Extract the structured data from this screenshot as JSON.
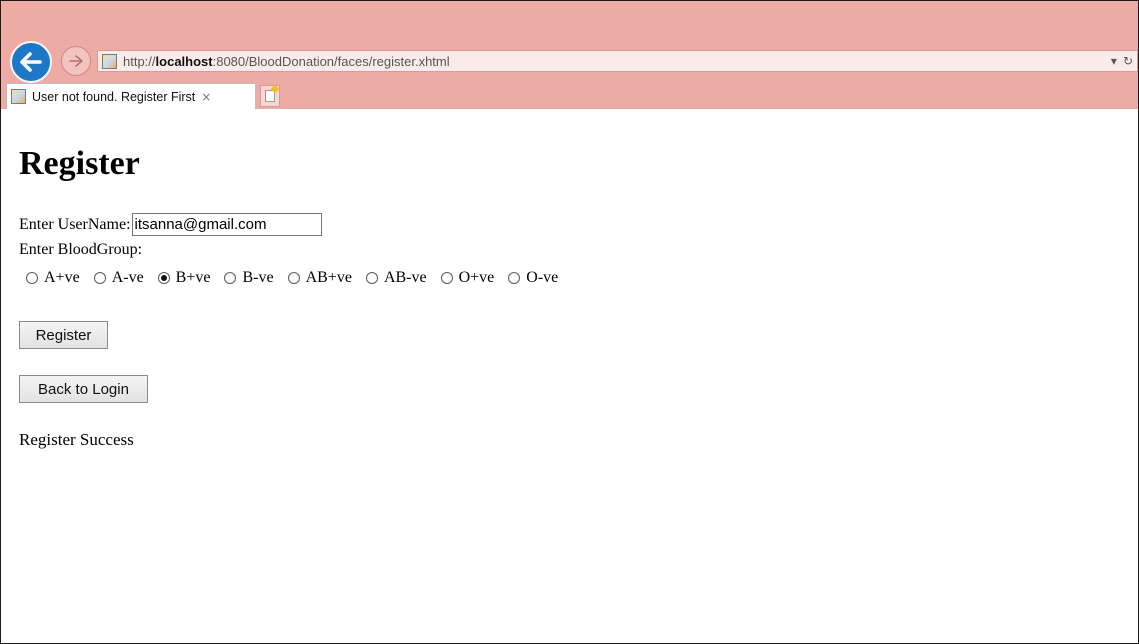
{
  "browser": {
    "url_prefix": "http://",
    "url_host": "localhost",
    "url_rest": ":8080/BloodDonation/faces/register.xhtml",
    "tab_title": "User not found. Register First",
    "tab_close": "×",
    "dropdown_glyph": "▾",
    "refresh_glyph": "↻"
  },
  "page": {
    "heading": "Register",
    "username_label": "Enter UserName:",
    "username_value": "itsanna@gmail.com",
    "bloodgroup_label": "Enter BloodGroup:",
    "blood_groups": [
      {
        "label": "A+ve",
        "checked": false
      },
      {
        "label": "A-ve",
        "checked": false
      },
      {
        "label": "B+ve",
        "checked": true
      },
      {
        "label": "B-ve",
        "checked": false
      },
      {
        "label": "AB+ve",
        "checked": false
      },
      {
        "label": "AB-ve",
        "checked": false
      },
      {
        "label": "O+ve",
        "checked": false
      },
      {
        "label": "O-ve",
        "checked": false
      }
    ],
    "register_button": "Register",
    "back_button": "Back to Login",
    "status_message": "Register Success"
  },
  "colors": {
    "chrome_bg": "#eeaaa5",
    "back_button": "#1d78c8"
  }
}
